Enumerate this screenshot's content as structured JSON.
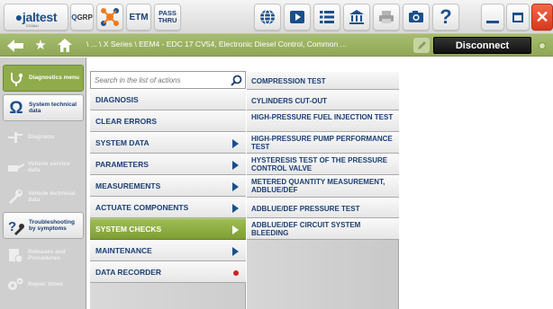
{
  "colors": {
    "accent_green": "#8fab4a",
    "nav_green": "#9bb363",
    "text_blue": "#1b3e73",
    "close_red": "#e34f2f",
    "record_red": "#d42020"
  },
  "toolbar": {
    "logo_text": "jaltest",
    "logo_sub": "COJALI",
    "grp_label": "GRP",
    "etm_label": "ETM",
    "pass_thru_line1": "PASS",
    "pass_thru_line2": "THRU",
    "icons": [
      "globe-icon",
      "play-icon",
      "list-icon",
      "bank-icon",
      "printer-icon",
      "camera-icon",
      "help-icon",
      "minimize-icon",
      "maximize-icon",
      "close-icon"
    ]
  },
  "navbar": {
    "breadcrumb": "\\ ... \\ X Series \\ EEM4 - EDC 17 CV54, Electronic Diesel Control, Common ...",
    "disconnect_label": "Disconnect"
  },
  "sidebar": {
    "items": [
      {
        "label": "Diagnostics menu",
        "icon": "stethoscope-icon",
        "state": "active"
      },
      {
        "label": "System technical data",
        "icon": "omega-icon",
        "state": "enabled"
      },
      {
        "label": "Diagrams",
        "icon": "diagram-icon",
        "state": "disabled"
      },
      {
        "label": "Vehicle service data",
        "icon": "oil-can-icon",
        "state": "disabled"
      },
      {
        "label": "Vehicle technical data",
        "icon": "wrench-icon",
        "state": "disabled"
      },
      {
        "label": "Troubleshooting by symptoms",
        "icon": "question-wrench-icon",
        "state": "enabled"
      },
      {
        "label": "Releases and Procedures",
        "icon": "procedures-icon",
        "state": "disabled"
      },
      {
        "label": "Repair times",
        "icon": "gears-icon",
        "state": "disabled"
      }
    ]
  },
  "actions": {
    "search_placeholder": "Search in the list of actions",
    "items": [
      {
        "label": "DIAGNOSIS",
        "arrow": false
      },
      {
        "label": "CLEAR ERRORS",
        "arrow": false
      },
      {
        "label": "SYSTEM DATA",
        "arrow": true
      },
      {
        "label": "PARAMETERS",
        "arrow": true
      },
      {
        "label": "MEASUREMENTS",
        "arrow": true
      },
      {
        "label": "ACTUATE COMPONENTS",
        "arrow": true
      },
      {
        "label": "SYSTEM CHECKS",
        "arrow": true,
        "active": true
      },
      {
        "label": "MAINTENANCE",
        "arrow": true
      },
      {
        "label": "DATA RECORDER",
        "arrow": false,
        "record": true
      }
    ]
  },
  "system_checks": {
    "items": [
      "COMPRESSION TEST",
      "CYLINDERS CUT-OUT",
      "HIGH-PRESSURE FUEL INJECTION TEST",
      "HIGH-PRESSURE PUMP PERFORMANCE TEST",
      "HYSTERESIS TEST OF THE PRESSURE CONTROL VALVE",
      "METERED QUANTITY MEASUREMENT, ADBLUE/DEF",
      "ADBLUE/DEF PRESSURE TEST",
      "ADBLUE/DEF CIRCUIT SYSTEM BLEEDING"
    ]
  }
}
